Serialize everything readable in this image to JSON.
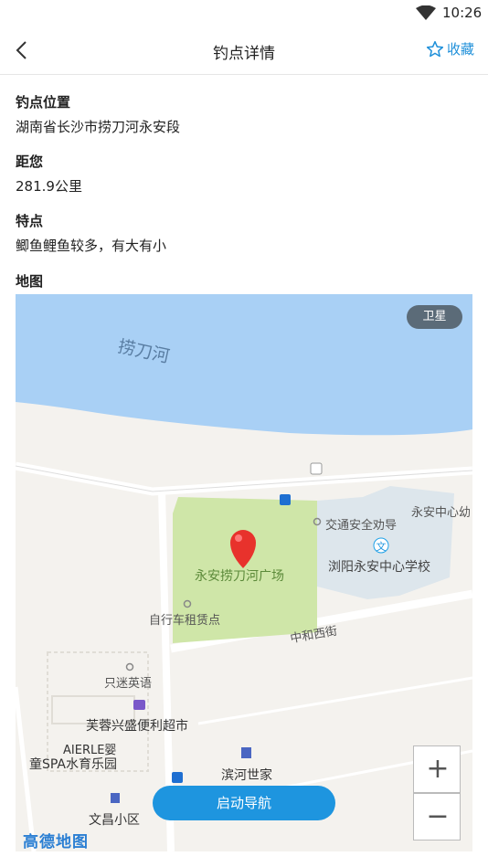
{
  "status": {
    "time": "10:26"
  },
  "header": {
    "title": "钓点详情",
    "favorite_label": "收藏"
  },
  "fields": [
    {
      "label": "钓点位置",
      "value": "湖南省长沙市捞刀河永安段"
    },
    {
      "label": "距您",
      "value": "281.9公里"
    },
    {
      "label": "特点",
      "value": "鲫鱼鲤鱼较多，有大有小"
    },
    {
      "label": "地图"
    }
  ],
  "map": {
    "river_label": "捞刀河",
    "satellite_label": "卫星",
    "labels": {
      "plaza": "永安捞刀河广场",
      "traffic": "交通安全劝导",
      "school": "浏阳永安中心学校",
      "school2": "永安中心幼",
      "bike": "自行车租赁点",
      "road": "中和西街",
      "english": "只迷英语",
      "market": "芙蓉兴盛便利超市",
      "aierle1": "AIERLE婴",
      "aierle2": "童SPA水育乐园",
      "binhe": "滨河世家",
      "wenchang": "文昌小区"
    },
    "zoom_in": "+",
    "zoom_out": "−",
    "navigate_label": "启动导航",
    "logo": "高德地图",
    "colors": {
      "water": "#a9d0f5",
      "park": "#cfe6a8",
      "school": "#dde6ec",
      "accent": "#1e95df"
    }
  }
}
